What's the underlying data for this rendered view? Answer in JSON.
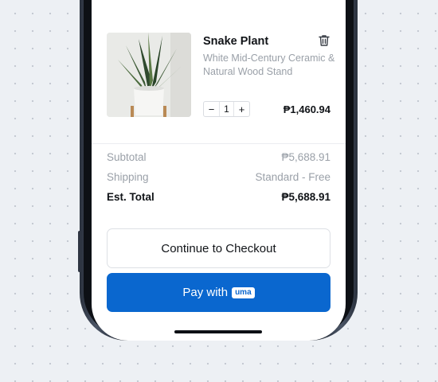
{
  "cart": {
    "item": {
      "name": "Snake Plant",
      "description": "White Mid-Century Ceramic & Natural Wood Stand",
      "quantity": "1",
      "decrement_symbol": "−",
      "increment_symbol": "+",
      "price": "₱1,460.94",
      "image": "snake-plant-photo"
    },
    "summary": {
      "subtotal_label": "Subtotal",
      "subtotal_value": "₱5,688.91",
      "shipping_label": "Shipping",
      "shipping_value": "Standard - Free",
      "total_label": "Est. Total",
      "total_value": "₱5,688.91"
    },
    "actions": {
      "checkout_label": "Continue to Checkout",
      "pay_label": "Pay with",
      "pay_badge": "uma"
    }
  },
  "icons": {
    "remove_item": "trash-icon"
  },
  "colors": {
    "primary": "#0a67cf",
    "text": "#111418",
    "muted": "#9aa0a8"
  }
}
